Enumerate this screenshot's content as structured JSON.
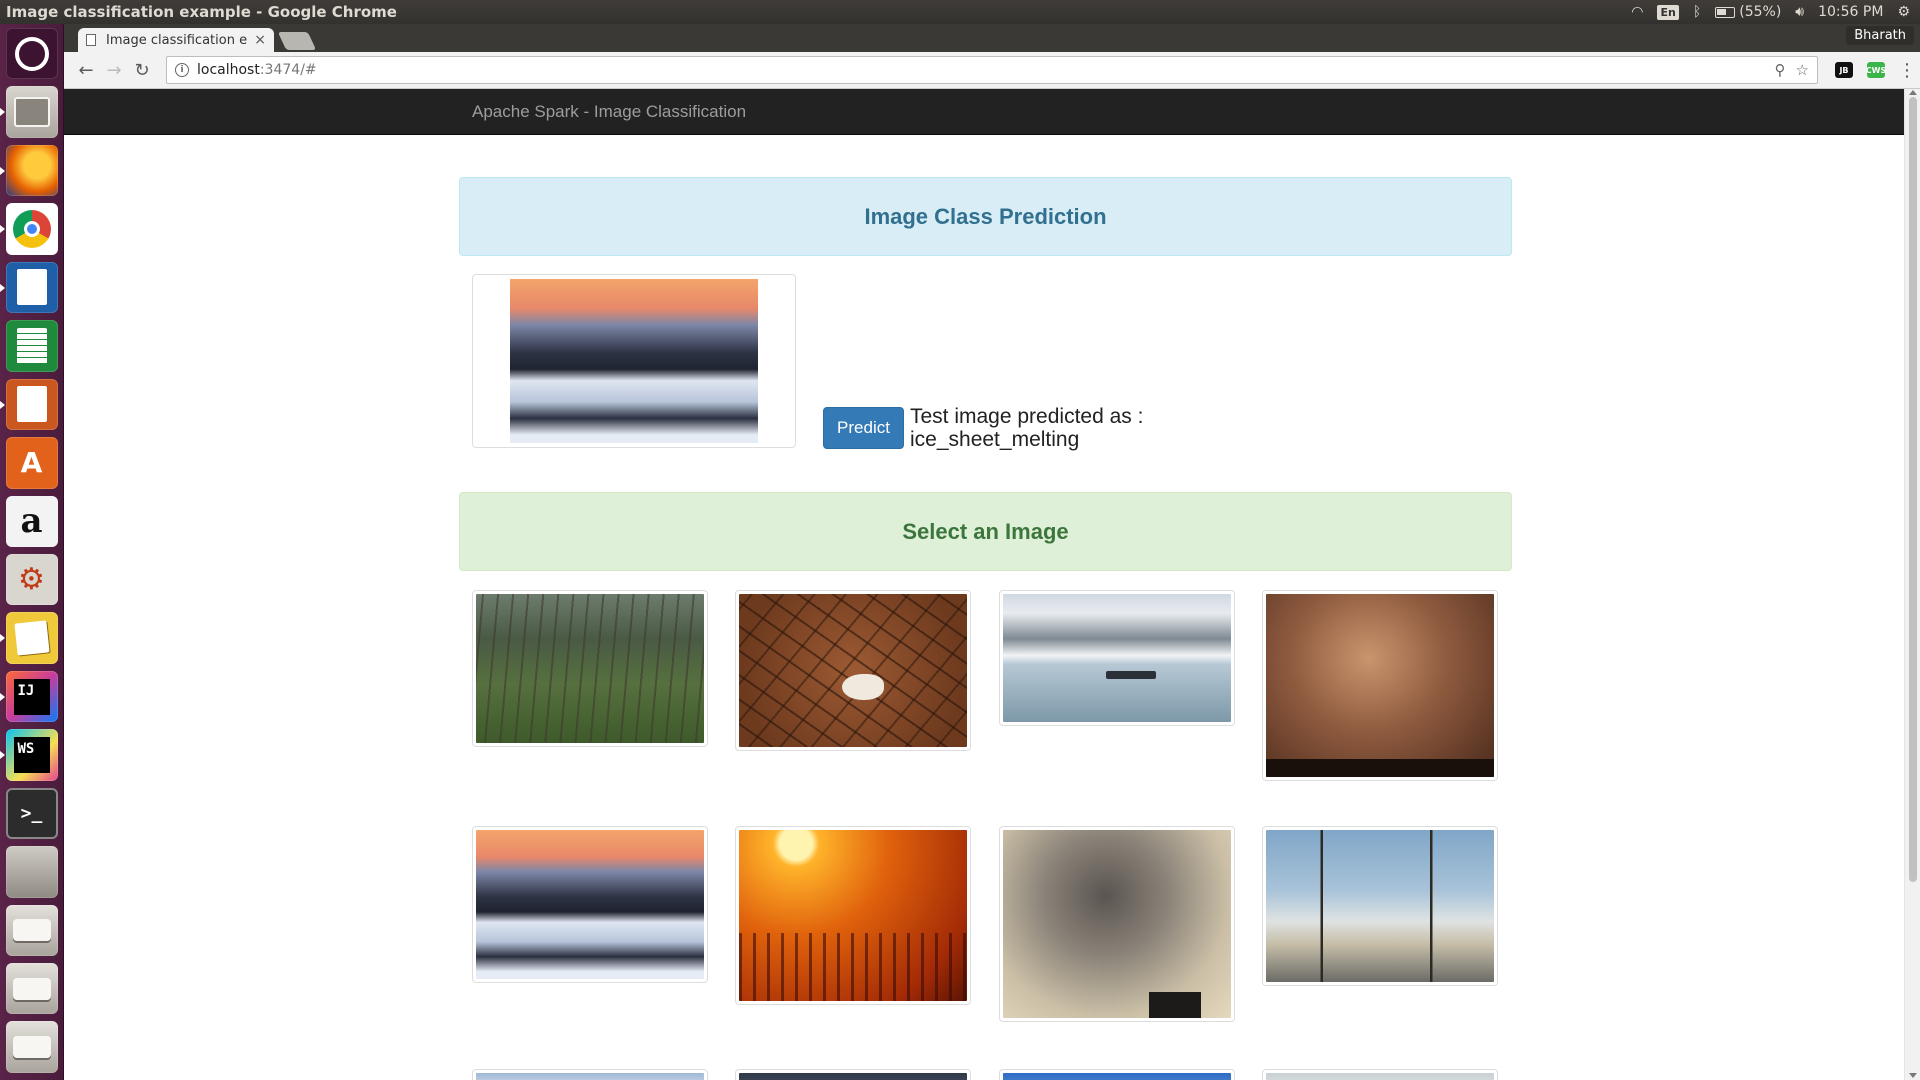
{
  "desktop": {
    "window_title": "Image classification example - Google Chrome",
    "tray": {
      "lang": "En",
      "battery": "(55%)",
      "clock": "10:56 PM"
    }
  },
  "launcher": {
    "items": [
      {
        "name": "dash-home",
        "glyph": ""
      },
      {
        "name": "files",
        "glyph": ""
      },
      {
        "name": "firefox",
        "glyph": ""
      },
      {
        "name": "chrome",
        "glyph": ""
      },
      {
        "name": "libreoffice-writer",
        "glyph": ""
      },
      {
        "name": "libreoffice-calc",
        "glyph": ""
      },
      {
        "name": "libreoffice-impress",
        "glyph": ""
      },
      {
        "name": "ubuntu-software",
        "glyph": "A"
      },
      {
        "name": "amazon",
        "glyph": "a"
      },
      {
        "name": "system-settings",
        "glyph": "⚙"
      },
      {
        "name": "text-editor",
        "glyph": ""
      },
      {
        "name": "intellij-idea",
        "glyph": "IJ"
      },
      {
        "name": "webstorm",
        "glyph": "WS"
      },
      {
        "name": "terminal",
        "glyph": ">_"
      },
      {
        "name": "scanner",
        "glyph": ""
      },
      {
        "name": "disk-1",
        "glyph": ""
      },
      {
        "name": "disk-2",
        "glyph": ""
      },
      {
        "name": "disk-3",
        "glyph": ""
      }
    ]
  },
  "browser": {
    "tab_title": "Image classification e",
    "tab_close": "×",
    "profile": "Bharath",
    "url_host": "localhost",
    "url_path": ":3474/#",
    "ext_jb": "JB",
    "ext_cws": "CWS"
  },
  "page": {
    "brand": "Apache Spark - Image Classification",
    "prediction_heading": "Image Class Prediction",
    "predict_button": "Predict",
    "prediction_label": "Test image predicted as :",
    "prediction_value": "ice_sheet_melting",
    "gallery_heading": "Select an Image",
    "gallery": [
      {
        "subject": "deforestation"
      },
      {
        "subject": "drought"
      },
      {
        "subject": "glacier"
      },
      {
        "subject": "power-plant-smoke"
      },
      {
        "subject": "ice-sheet-melting"
      },
      {
        "subject": "wildfire-sunset"
      },
      {
        "subject": "smokestack-pollution"
      },
      {
        "subject": "palm-trees-heat"
      },
      {
        "subject": "ice"
      },
      {
        "subject": "dark-landscape"
      },
      {
        "subject": "mountains"
      },
      {
        "subject": "fog"
      }
    ]
  }
}
